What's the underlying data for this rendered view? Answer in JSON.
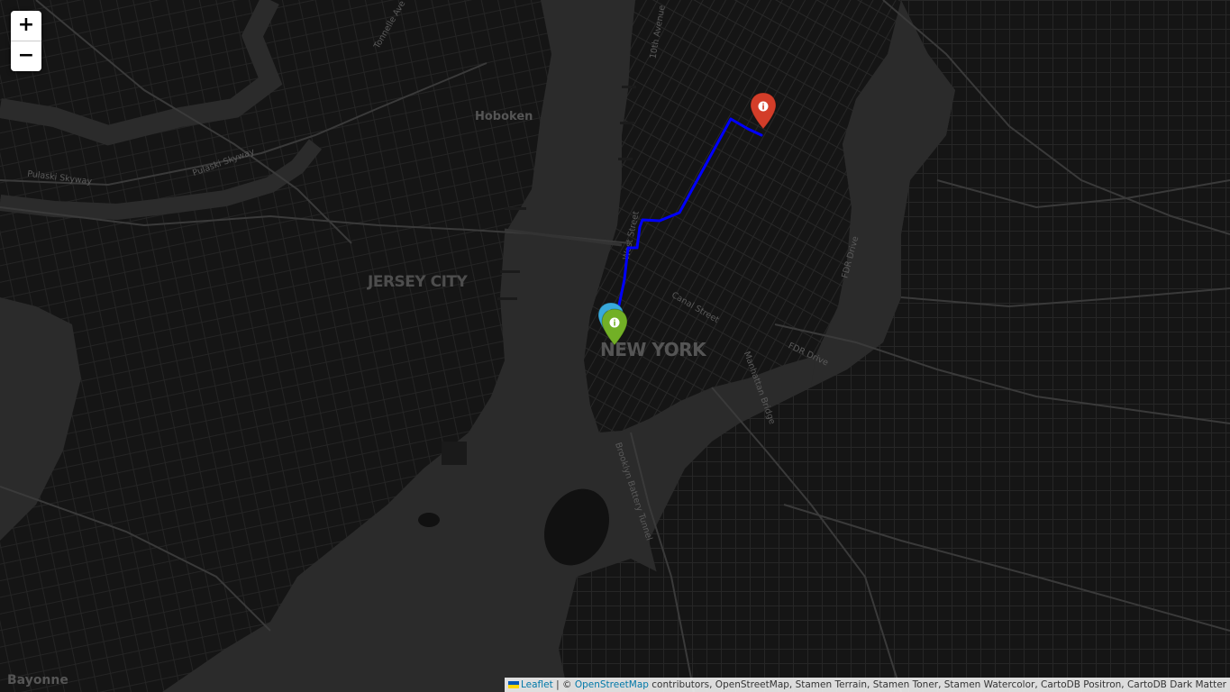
{
  "map": {
    "zoom_in_label": "+",
    "zoom_out_label": "−",
    "labels": {
      "hoboken": "Hoboken",
      "jersey_city": "JERSEY CITY",
      "new_york": "NEW YORK",
      "bayonne": "Bayonne",
      "pulaski": "Pulaski Skyway",
      "tonnelle": "Tonnelle Ave",
      "west_street": "West Street",
      "canal_street": "Canal Street",
      "fdr_drive_1": "FDR Drive",
      "fdr_drive_2": "FDR Drive",
      "manhattan_bridge": "Manhattan Bridge",
      "brooklyn_battery": "Brooklyn Battery Tunnel",
      "tenth_avenue": "10th Avenue"
    },
    "markers": [
      {
        "name": "start-marker",
        "color": "#38a9dc",
        "icon": "info-icon",
        "glyph": "i"
      },
      {
        "name": "waypoint-marker",
        "color": "#72b026",
        "icon": "info-icon",
        "glyph": "i"
      },
      {
        "name": "end-marker",
        "color": "#d33d29",
        "icon": "info-icon",
        "glyph": "i"
      }
    ],
    "route": {
      "color": "#0000ff"
    }
  },
  "attribution": {
    "leaflet": "Leaflet",
    "separator": "| ©",
    "osm": "OpenStreetMap",
    "rest": "contributors, OpenStreetMap, Stamen Terrain, Stamen Toner, Stamen Watercolor, CartoDB Positron, CartoDB Dark Matter",
    "flag_colors": [
      "#0057b7",
      "#ffd700"
    ]
  }
}
